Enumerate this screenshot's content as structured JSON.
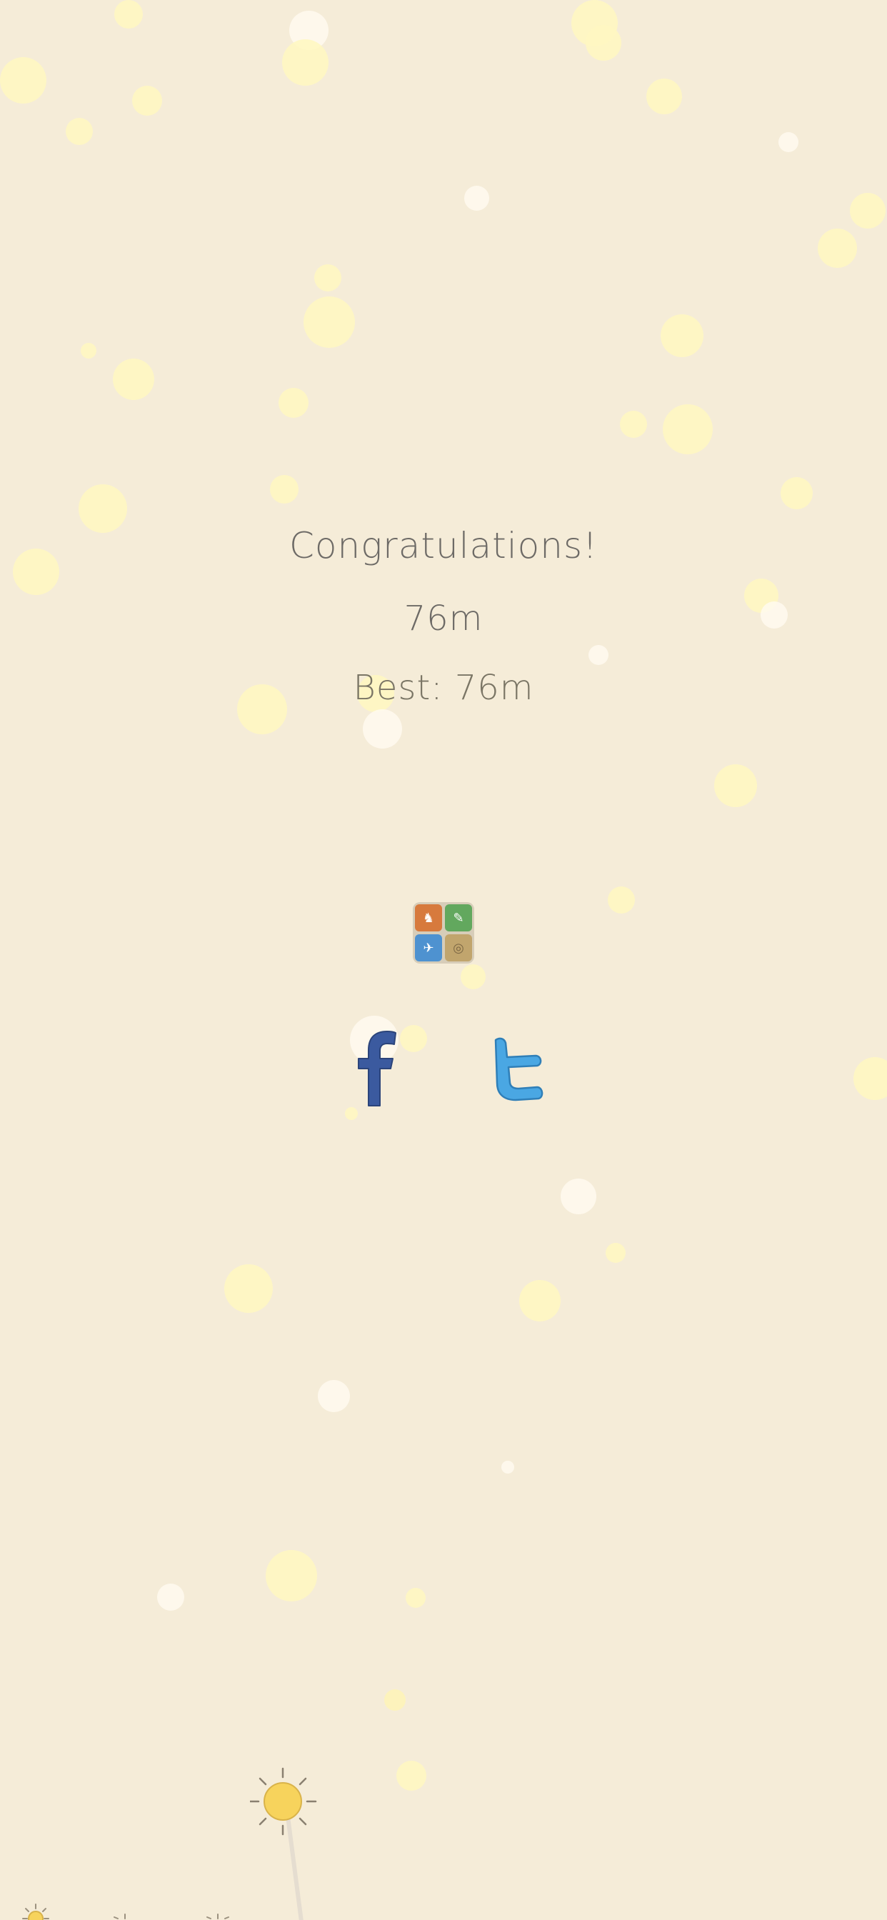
{
  "result": {
    "congrats_text": "Congratulations!",
    "distance_text": "76m",
    "best_text": "Best: 76m"
  },
  "buttons": {
    "game_center_icon": "game-center-icon",
    "facebook_icon": "facebook-icon",
    "twitter_icon": "twitter-icon"
  },
  "colors": {
    "background": "#f5ecd8",
    "text": "#6d6a66",
    "bubble": "#fff7c2",
    "facebook": "#3b5a9f",
    "twitter": "#4aa7e3"
  }
}
